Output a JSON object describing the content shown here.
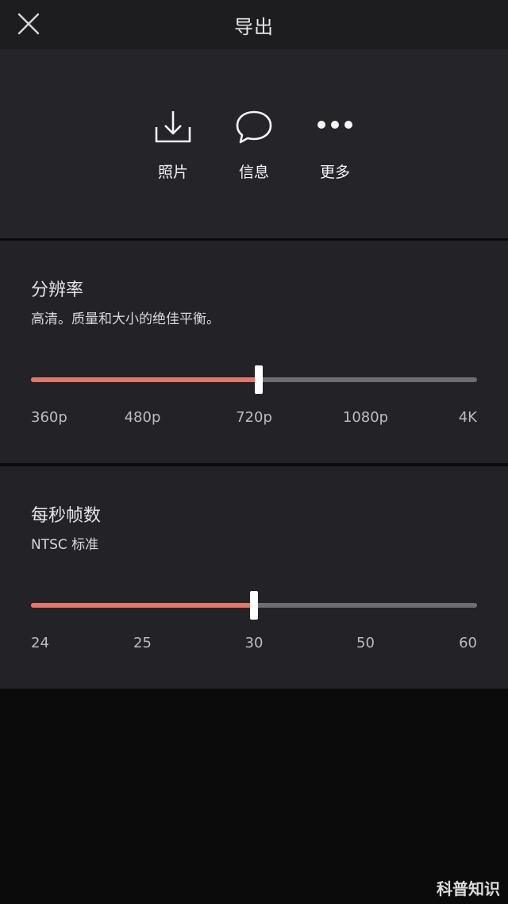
{
  "header": {
    "title": "导出",
    "close_icon": "close-icon"
  },
  "share": {
    "items": [
      {
        "label": "照片",
        "icon": "download-icon"
      },
      {
        "label": "信息",
        "icon": "chat-bubble-icon"
      },
      {
        "label": "更多",
        "icon": "more-dots-icon"
      }
    ]
  },
  "resolution": {
    "title": "分辨率",
    "description": "高清。质量和大小的绝佳平衡。",
    "options": [
      "360p",
      "480p",
      "720p",
      "1080p",
      "4K"
    ],
    "selected": "720p",
    "selected_fraction": 0.51
  },
  "fps": {
    "title": "每秒帧数",
    "description": "NTSC 标准",
    "options": [
      "24",
      "25",
      "30",
      "50",
      "60"
    ],
    "selected": "30",
    "selected_fraction": 0.5
  },
  "colors": {
    "accent": "#e2776b",
    "track": "#6e6e72",
    "panel": "#242429"
  },
  "watermark": "科普知识"
}
